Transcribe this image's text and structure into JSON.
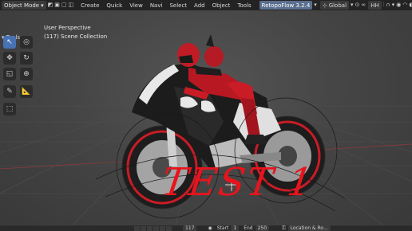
{
  "header": {
    "mode": "Object Mode",
    "menus": [
      "Create",
      "Quick",
      "View",
      "Navi",
      "Select",
      "Add",
      "Object",
      "Tools"
    ],
    "addon": "RetopoFlow 3.2.4",
    "orientation": "Global",
    "hh": "HH"
  },
  "toolbar": {
    "label": "Tools",
    "tools": [
      "select-box-tool",
      "cursor-tool",
      "move-tool",
      "rotate-tool",
      "scale-tool",
      "transform-tool",
      "annotate-tool",
      "measure-tool",
      "add-cube-tool"
    ]
  },
  "viewport": {
    "perspective": "User Perspective",
    "collection": "(117) Scene Collection",
    "overlay_text": "TEST 1"
  },
  "timeline": {
    "frame": "117",
    "start_label": "Start",
    "start": "1",
    "end_label": "End",
    "end": "250",
    "location_label": "Location & Ro..."
  },
  "colors": {
    "accent": "#4772b3",
    "overlay": "#e8141c",
    "bike_primary": "#1c1c1c",
    "bike_accent": "#d21e2a"
  }
}
